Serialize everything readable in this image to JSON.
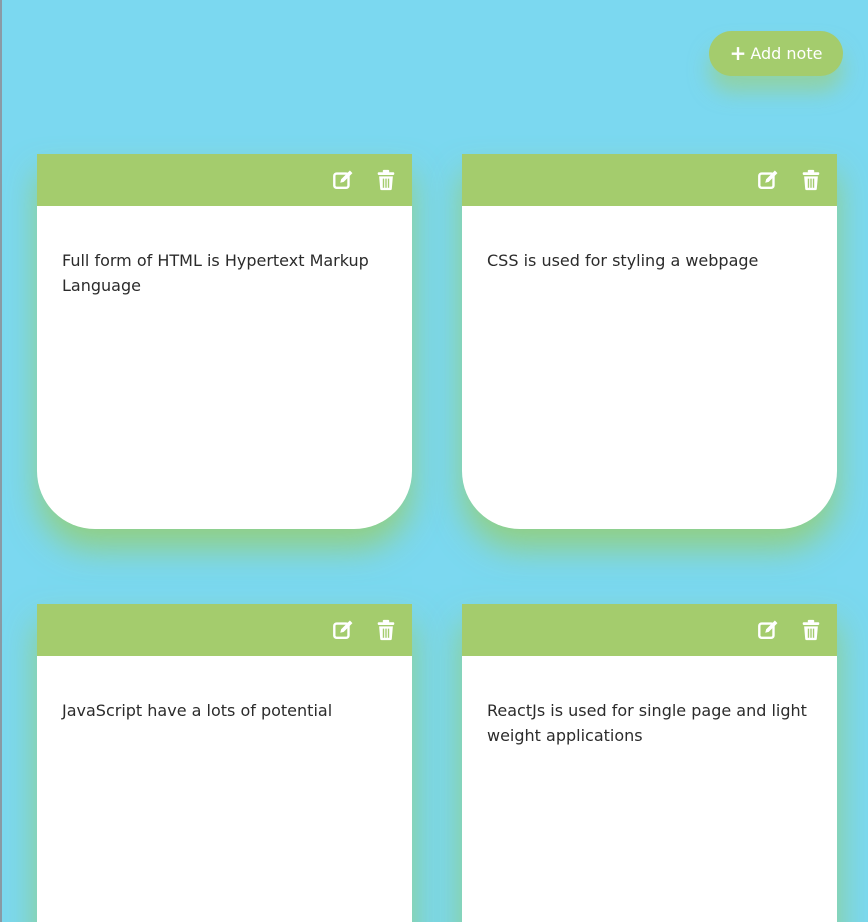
{
  "toolbar": {
    "add_note_label": "Add note"
  },
  "notes": [
    {
      "text": "Full form of HTML is Hypertext Markup Language",
      "icons": [
        "edit-icon",
        "trash-icon"
      ]
    },
    {
      "text": "CSS is used for styling a webpage",
      "icons": [
        "edit-icon",
        "trash-icon"
      ]
    },
    {
      "text": "JavaScript have a lots of potential",
      "icons": [
        "edit-icon",
        "trash-icon"
      ]
    },
    {
      "text": "ReactJs is used for single page and light weight applications",
      "icons": [
        "edit-icon",
        "trash-icon"
      ]
    }
  ],
  "colors": {
    "background": "#7bd8f0",
    "accent": "#a4cc6d",
    "card": "#ffffff",
    "text": "#2b2b2b"
  }
}
